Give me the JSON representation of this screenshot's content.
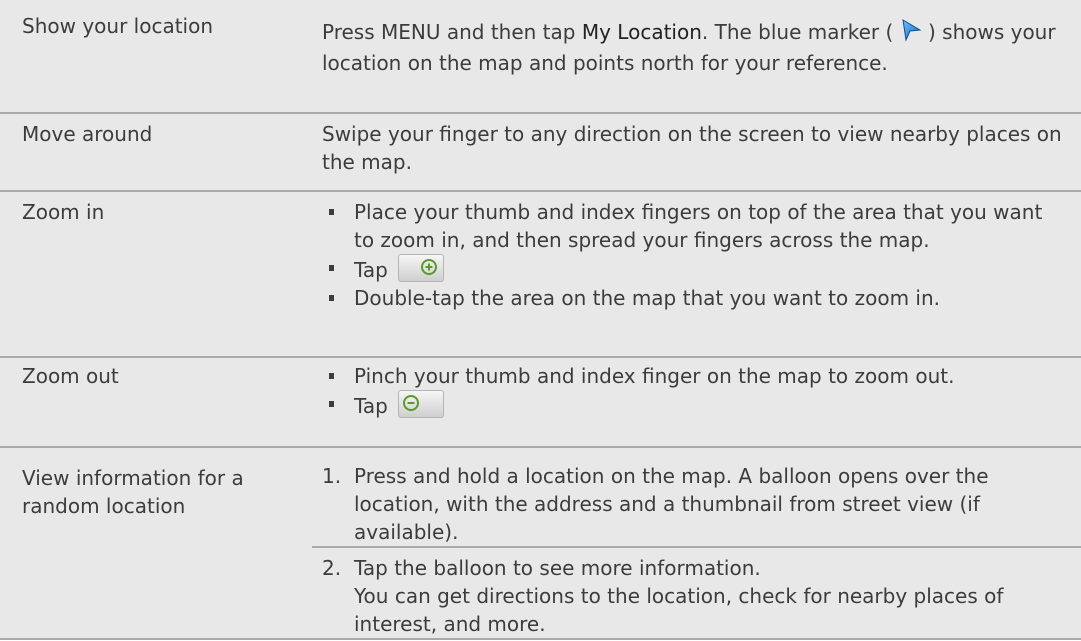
{
  "rows": [
    {
      "label": "Show your location",
      "desc_before": "Press MENU and then tap ",
      "desc_bold": "My Location",
      "desc_mid": ". The blue marker ( ",
      "desc_after": " ) shows your location on the map and points north for your reference."
    },
    {
      "label": "Move around",
      "desc": "Swipe your finger to any direction on the screen to view nearby places on the map."
    },
    {
      "label": "Zoom in",
      "bullets": [
        "Place your thumb and index fingers on top of the area that you want to zoom in, and then spread your fingers across the map.",
        "Tap",
        "Double-tap the area on the map that you want to zoom in."
      ]
    },
    {
      "label": "Zoom out",
      "bullets": [
        "Pinch your thumb and index finger on the map to zoom out.",
        "Tap"
      ]
    },
    {
      "label": "View information for a random location",
      "steps": [
        {
          "num": "1.",
          "text": "Press and hold a location on the map. A balloon opens over the location, with the address and a thumbnail from street view (if available)."
        },
        {
          "num": "2.",
          "text": "Tap the balloon to see more information.",
          "subtext": "You can get directions to the location, check for nearby places of interest, and more."
        }
      ]
    }
  ],
  "icons": {
    "marker": "blue-location-marker-icon",
    "zoom_in": "zoom-in-button-icon",
    "zoom_out": "zoom-out-button-icon"
  },
  "colors": {
    "row_bg": "#e8e8e8",
    "divider": "#aaaaaa",
    "text": "#3c3c3c",
    "marker_blue": "#2a8fd8"
  }
}
